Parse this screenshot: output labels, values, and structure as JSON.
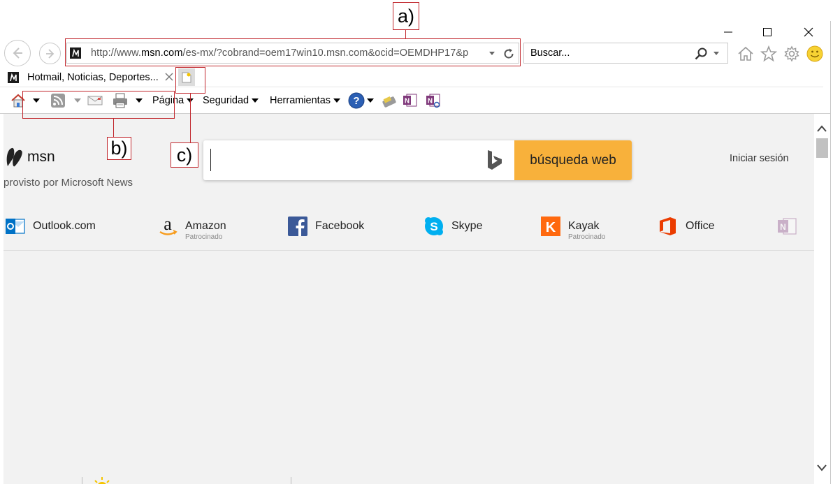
{
  "browser": {
    "address": {
      "prefix": "http://www.",
      "domain": "msn.com",
      "rest": "/es-mx/?cobrand=oem17win10.msn.com&ocid=OEMDHP17&p"
    },
    "search_placeholder": "Buscar...",
    "tab_title": "Hotmail, Noticias, Deportes...",
    "tab_close": "×"
  },
  "commandbar": {
    "page_label": "Página",
    "security_label": "Seguridad",
    "tools_label": "Herramientas"
  },
  "content": {
    "msn_word": "msn",
    "msn_sub": "provisto por Microsoft News",
    "search_button": "búsqueda web",
    "signin": "Iniciar sesión",
    "quicklinks": [
      {
        "name": "Outlook.com",
        "sub": ""
      },
      {
        "name": "Amazon",
        "sub": "Patrocinado"
      },
      {
        "name": "Facebook",
        "sub": ""
      },
      {
        "name": "Skype",
        "sub": ""
      },
      {
        "name": "Kayak",
        "sub": "Patrocinado"
      },
      {
        "name": "Office",
        "sub": ""
      }
    ]
  },
  "annotations": {
    "a": "a)",
    "b": "b)",
    "c": "c)"
  },
  "colors": {
    "accent_orange": "#f8b13b",
    "annotation_red": "#c1272d",
    "content_bg": "#f2f2f2"
  }
}
